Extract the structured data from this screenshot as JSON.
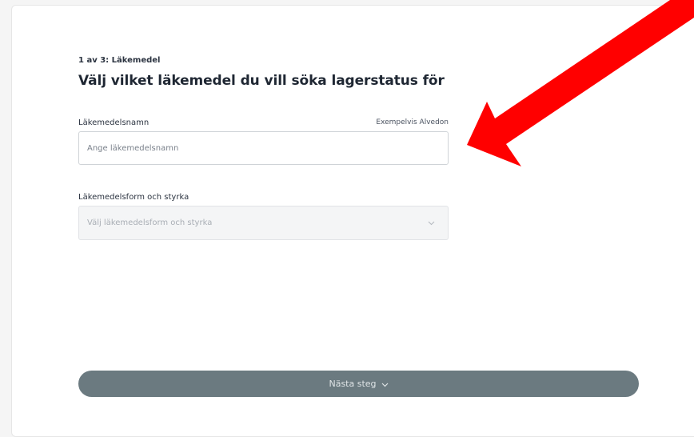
{
  "form": {
    "step_label": "1 av 3: Läkemedel",
    "title": "Välj vilket läkemedel du vill söka lagerstatus för",
    "medicine_name": {
      "label": "Läkemedelsnamn",
      "hint": "Exempelvis Alvedon",
      "placeholder": "Ange läkemedelsnamn",
      "value": ""
    },
    "medicine_form": {
      "label": "Läkemedelsform och styrka",
      "placeholder": "Välj läkemedelsform och styrka"
    },
    "next_button": {
      "label": "Nästa steg"
    }
  },
  "annotation": {
    "arrow_color": "#ff0000",
    "arrow_icon": "red-arrow-icon"
  },
  "colors": {
    "button_bg": "#6b7a80",
    "text_primary": "#1f2733",
    "disabled_bg": "#f4f5f6"
  }
}
